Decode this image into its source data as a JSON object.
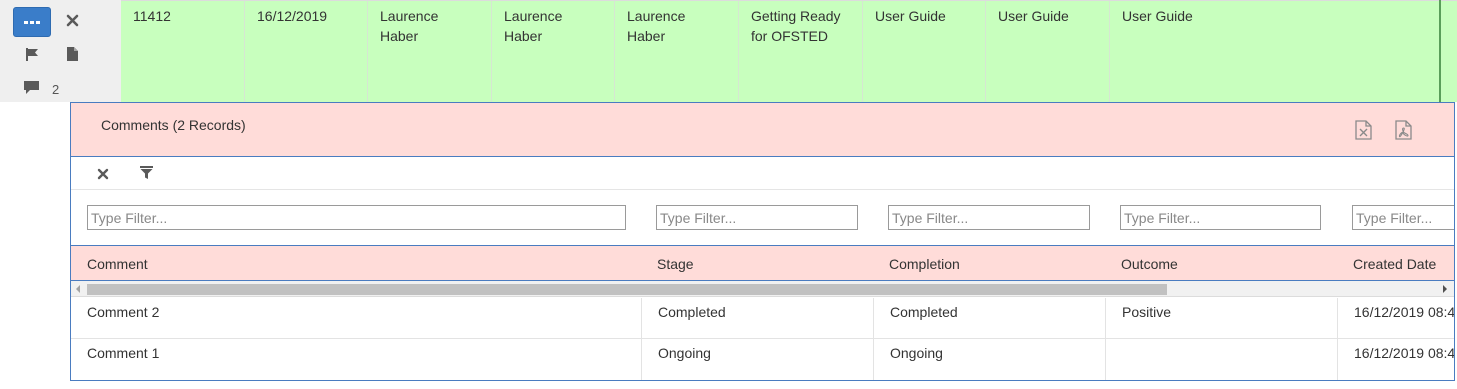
{
  "parent_row": {
    "comment_count": "2",
    "cells": [
      "11412",
      "16/12/2019",
      "Laurence Haber",
      "Laurence Haber",
      "Laurence Haber",
      "Getting Ready for OFSTED",
      "User Guide",
      "User Guide",
      "User Guide"
    ]
  },
  "comments_panel": {
    "title": "Comments (2 Records)",
    "filter_placeholder": "Type Filter...",
    "columns": [
      "Comment",
      "Stage",
      "Completion",
      "Outcome",
      "Created Date"
    ],
    "rows": [
      [
        "Comment 2",
        "Completed",
        "Completed",
        "Positive",
        "16/12/2019 08:4"
      ],
      [
        "Comment 1",
        "Ongoing",
        "Ongoing",
        "",
        "16/12/2019 08:4"
      ]
    ]
  },
  "colors": {
    "row_green": "#c8ffbe",
    "header_pink": "#ffdcd9",
    "accent_blue": "#3a7dc9",
    "panel_border": "#4a7cc0"
  },
  "icons": [
    "more-icon",
    "close-icon",
    "flag-icon",
    "file-icon",
    "comment-icon",
    "excel-export-icon",
    "pdf-export-icon",
    "clear-filter-icon",
    "filter-icon"
  ]
}
